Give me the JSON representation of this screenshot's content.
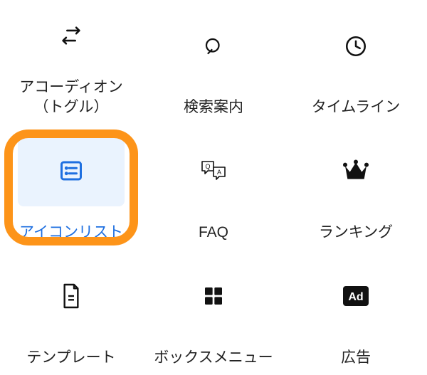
{
  "grid": {
    "items": [
      {
        "label": "アコーディオン\n（トグル）",
        "icon": "toggle-icon",
        "selected": false
      },
      {
        "label": "検索案内",
        "icon": "search-icon",
        "selected": false
      },
      {
        "label": "タイムライン",
        "icon": "clock-icon",
        "selected": false
      },
      {
        "label": "アイコンリスト",
        "icon": "icon-list-icon",
        "selected": true
      },
      {
        "label": "FAQ",
        "icon": "faq-icon",
        "selected": false
      },
      {
        "label": "ランキング",
        "icon": "crown-icon",
        "selected": false
      },
      {
        "label": "テンプレート",
        "icon": "template-icon",
        "selected": false
      },
      {
        "label": "ボックスメニュー",
        "icon": "box-menu-icon",
        "selected": false
      },
      {
        "label": "広告",
        "icon": "ad-icon",
        "selected": false
      }
    ],
    "colors": {
      "selected_text": "#1e6fe0",
      "selected_bg": "#eaf3fe",
      "highlight_ring": "#f7931e"
    }
  }
}
